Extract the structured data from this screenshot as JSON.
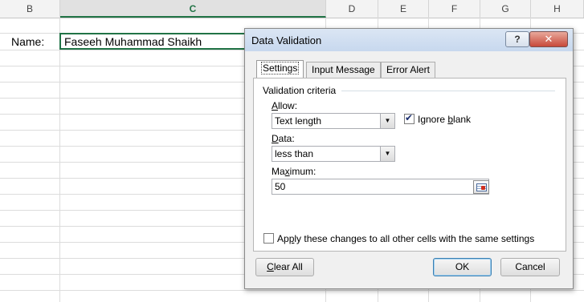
{
  "sheet": {
    "columns": [
      "B",
      "C",
      "D",
      "E",
      "F",
      "G",
      "H"
    ],
    "selected_column": "C",
    "label_cell": "Name:",
    "active_cell_value": "Faseeh Muhammad Shaikh"
  },
  "dialog": {
    "title": "Data Validation",
    "help_glyph": "?",
    "close_glyph": "✕",
    "tabs": [
      "Settings",
      "Input Message",
      "Error Alert"
    ],
    "active_tab": "Settings",
    "group_label": "Validation criteria",
    "allow": {
      "label_pre": "",
      "label_key": "A",
      "label_post": "llow:",
      "value": "Text length"
    },
    "ignore_blank": {
      "label_pre": "Ignore ",
      "label_key": "b",
      "label_post": "lank",
      "checked": true
    },
    "data": {
      "label_pre": "",
      "label_key": "D",
      "label_post": "ata:",
      "value": "less than"
    },
    "maximum": {
      "label_pre": "Ma",
      "label_key": "x",
      "label_post": "imum:",
      "value": "50"
    },
    "apply_all": {
      "label_pre": "Ap",
      "label_key": "p",
      "label_post": "ly these changes to all other cells with the same settings",
      "checked": false
    },
    "buttons": {
      "clear_all_pre": "",
      "clear_all_key": "C",
      "clear_all_post": "lear All",
      "ok": "OK",
      "cancel": "Cancel"
    }
  },
  "colors": {
    "excel_green": "#217346",
    "dialog_bg": "#f0f0f0",
    "close_red": "#c7493a"
  }
}
